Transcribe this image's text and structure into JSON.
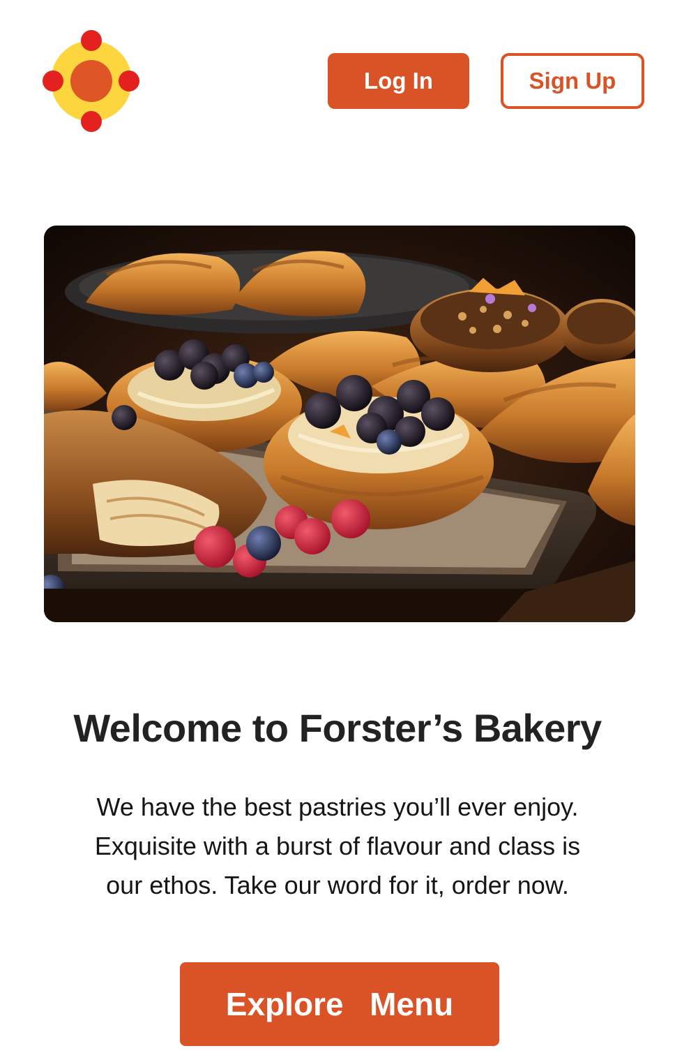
{
  "brand": {
    "logo_icon": "flower-dots-logo",
    "colors": {
      "accent": "#d95326",
      "logo_yellow": "#fcd53f",
      "logo_red": "#e3211f",
      "logo_orange": "#de5526"
    }
  },
  "header": {
    "login_label": "Log In",
    "signup_label": "Sign Up"
  },
  "hero": {
    "image_alt": "pastries"
  },
  "main": {
    "title": "Welcome to Forster’s Bakery",
    "description_lines": [
      "We have the best pastries you’ll ever enjoy.",
      "Exquisite with a burst of flavour and class is",
      "our ethos. Take our word for it, order now."
    ],
    "cta_label": "Explore  Menu"
  }
}
